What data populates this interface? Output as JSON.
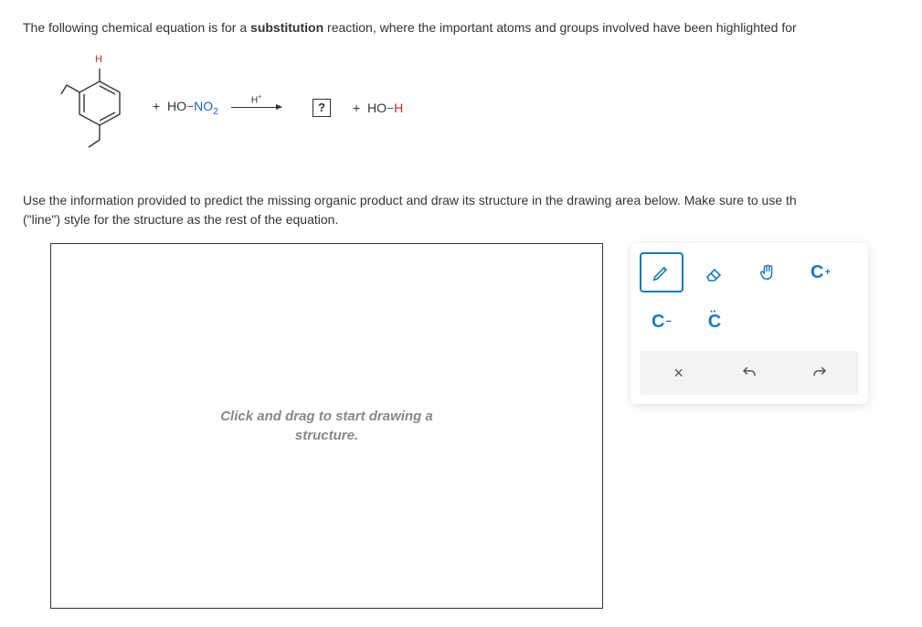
{
  "question": {
    "intro_pre": "The following chemical equation is for a ",
    "intro_bold": "substitution",
    "intro_post": " reaction, where the important atoms and groups involved have been highlighted for"
  },
  "equation": {
    "reagent1_plus": "+",
    "reagent1_HO": "HO",
    "reagent1_dash": "−",
    "reagent1_NO2_N": "NO",
    "reagent1_NO2_sub": "2",
    "arrow_label_H": "H",
    "arrow_label_sup": "+",
    "unknown_symbol": "?",
    "product_plus": "+",
    "product_HO": "HO",
    "product_dash": "−",
    "product_H": "H",
    "molecule_top_H": "H"
  },
  "instruction": {
    "line1": "Use the information provided to predict the missing organic product and draw its structure in the drawing area below. Make sure to use th",
    "line2": "(\"line\") style for the structure as the rest of the equation."
  },
  "canvas": {
    "placeholder_l1": "Click and drag to start drawing a",
    "placeholder_l2": "structure."
  },
  "tools": {
    "c_minus": "C",
    "c_dots": "C",
    "c_plus": "C",
    "minus_sup": "−",
    "plus_sup": "+"
  },
  "actions": {
    "clear": "×"
  }
}
